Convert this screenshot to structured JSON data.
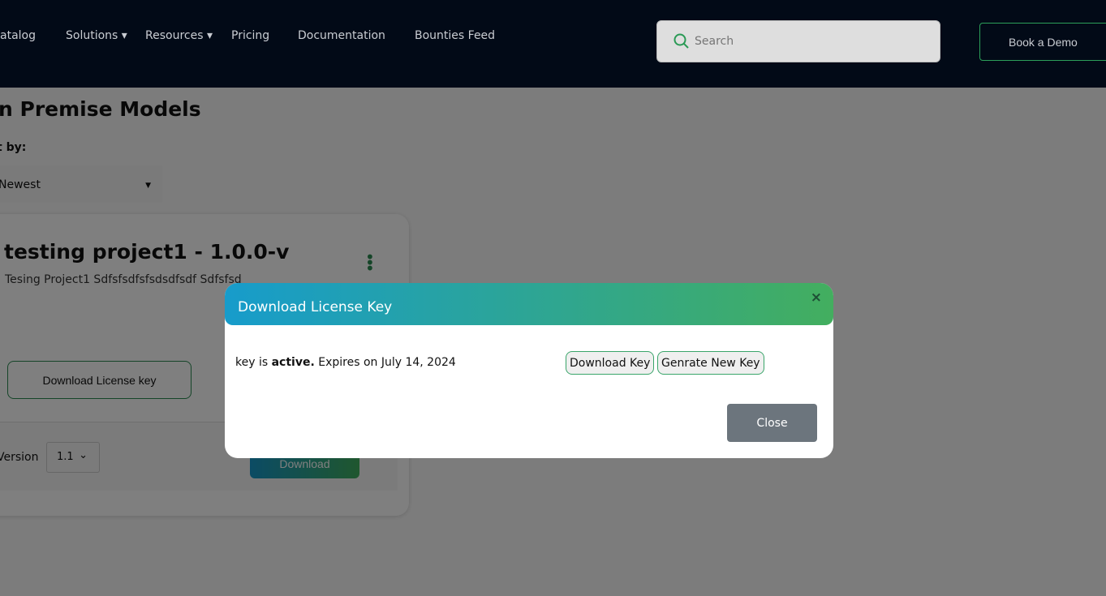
{
  "header": {
    "nav": [
      {
        "label": "atalog"
      },
      {
        "label": "Solutions ▾"
      },
      {
        "label": "Resources ▾"
      },
      {
        "label": "Pricing"
      },
      {
        "label": "Documentation"
      },
      {
        "label": "Bounties Feed"
      }
    ],
    "search_placeholder": "Search",
    "demo_label": "Book a Demo"
  },
  "page": {
    "title": "n Premise Models",
    "sort_label": "t by:",
    "sort_value": "Newest"
  },
  "card": {
    "title": "testing project1 - 1.0.0-v",
    "description": "Tesing Project1 Sdfsfsdfsfsdsdfsdf Sdfsfsd",
    "license_button": "Download License key",
    "version_label": "Version",
    "version_value": "1.1",
    "download_button": "Download"
  },
  "modal": {
    "title": "Download License Key",
    "text_prefix": "key is ",
    "status": "active.",
    "text_suffix": " Expires on July 14, 2024",
    "download_key": "Download Key",
    "generate_key": "Genrate New Key",
    "close": "Close",
    "close_icon": "×"
  }
}
